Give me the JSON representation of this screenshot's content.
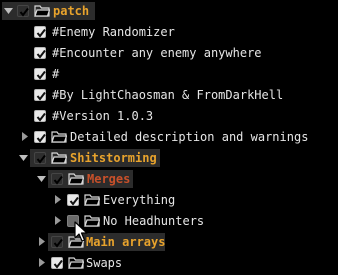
{
  "tree": {
    "nodes": [
      {
        "label": "patch",
        "checked": true,
        "expanded": true,
        "folder": true
      },
      {
        "label": "#Enemy Randomizer",
        "checked": true,
        "folder": false
      },
      {
        "label": "#Encounter any enemy anywhere",
        "checked": true,
        "folder": false
      },
      {
        "label": "#",
        "checked": true,
        "folder": false
      },
      {
        "label": "#By LightChaosman & FromDarkHell",
        "checked": true,
        "folder": false
      },
      {
        "label": "#Version 1.0.3",
        "checked": true,
        "folder": false
      },
      {
        "label": "Detailed description and warnings",
        "checked": true,
        "expanded": false,
        "folder": true
      },
      {
        "label": "Shitstorming",
        "checked": true,
        "expanded": true,
        "folder": true
      },
      {
        "label": "Merges",
        "checked": true,
        "expanded": true,
        "folder": true
      },
      {
        "label": "Everything",
        "checked": true,
        "expanded": false,
        "folder": true
      },
      {
        "label": "No Headhunters",
        "checked": false,
        "expanded": false,
        "folder": true
      },
      {
        "label": "Main arrays",
        "checked": true,
        "expanded": false,
        "folder": true
      },
      {
        "label": "Swaps",
        "checked": true,
        "expanded": false,
        "folder": true
      }
    ]
  },
  "colors": {
    "background": "#000000",
    "text": "#e6e6e6",
    "highlight_orange": "#e8a32c",
    "highlight_red": "#c8502a",
    "row_highlight": "#2c2c2c"
  },
  "icons": {
    "expanded": "triangle-down-icon",
    "collapsed": "triangle-right-icon",
    "folder": "folder-open-icon",
    "checkbox": "checkbox-icon",
    "cursor": "mouse-pointer-icon"
  }
}
